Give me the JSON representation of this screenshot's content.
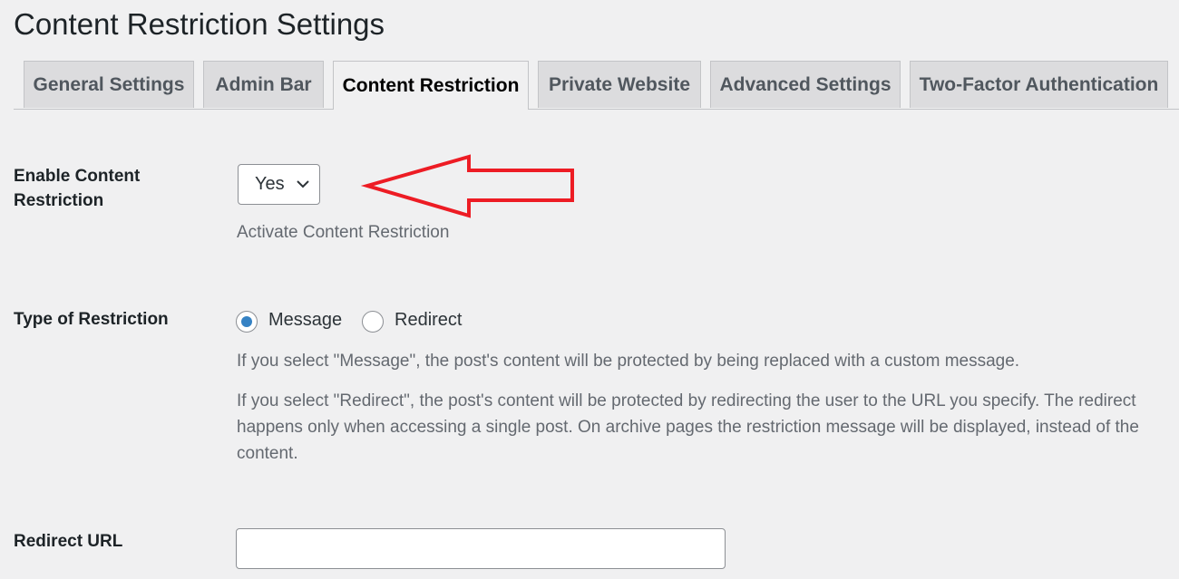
{
  "page_title": "Content Restriction Settings",
  "tabs": [
    {
      "label": "General Settings",
      "active": false
    },
    {
      "label": "Admin Bar",
      "active": false
    },
    {
      "label": "Content Restriction",
      "active": true
    },
    {
      "label": "Private Website",
      "active": false
    },
    {
      "label": "Advanced Settings",
      "active": false
    },
    {
      "label": "Two-Factor Authentication",
      "active": false
    }
  ],
  "enable": {
    "label": "Enable Content Restriction",
    "value": "Yes",
    "description": "Activate Content Restriction"
  },
  "restriction_type": {
    "label": "Type of Restriction",
    "options": [
      {
        "label": "Message",
        "checked": true
      },
      {
        "label": "Redirect",
        "checked": false
      }
    ],
    "desc_message": "If you select \"Message\", the post's content will be protected by being replaced with a custom message.",
    "desc_redirect": "If you select \"Redirect\", the post's content will be protected by redirecting the user to the URL you specify. The redirect happens only when accessing a single post. On archive pages the restriction message will be displayed, instead of the content."
  },
  "redirect_url": {
    "label": "Redirect URL",
    "value": ""
  },
  "annotation": {
    "color": "#ed1c24",
    "icon": "arrow-left-icon"
  }
}
